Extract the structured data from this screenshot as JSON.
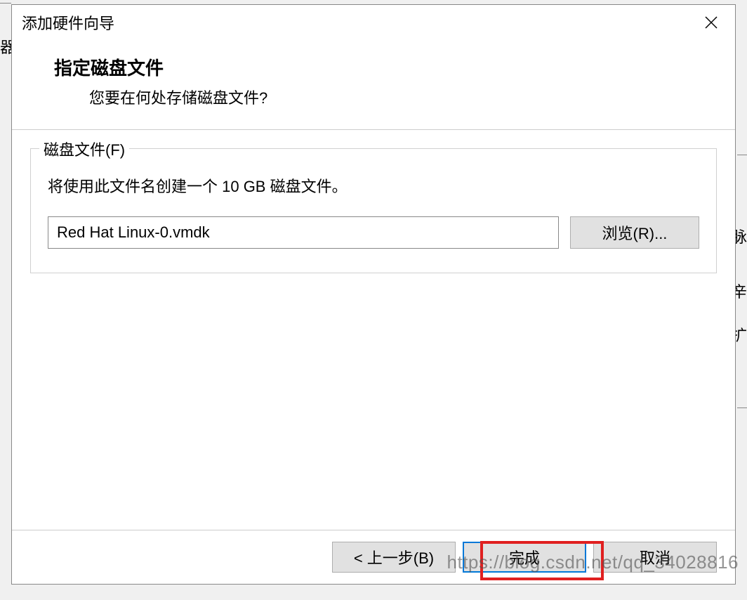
{
  "dialog": {
    "title": "添加硬件向导",
    "header_title": "指定磁盘文件",
    "header_subtitle": "您要在何处存储磁盘文件?"
  },
  "fieldset": {
    "legend": "磁盘文件(F)",
    "description": "将使用此文件名创建一个 10 GB 磁盘文件。",
    "file_value": "Red Hat Linux-0.vmdk",
    "browse_label": "浏览(R)..."
  },
  "buttons": {
    "back": "< 上一步(B)",
    "finish": "完成",
    "cancel": "取消"
  },
  "watermark": "https://blog.csdn.net/qq_34028816",
  "background": {
    "char1": "器",
    "char2": "脉",
    "char3": "辛",
    "char4": "扩"
  }
}
